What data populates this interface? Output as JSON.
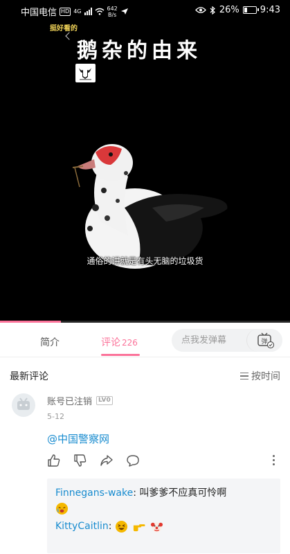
{
  "status_bar": {
    "carrier": "中国电信",
    "network": "4G",
    "speed_value": "642",
    "speed_unit": "B/s",
    "battery": "26%",
    "battery_level": 0.26,
    "time": "9:43"
  },
  "video": {
    "tagline": "挺好看的",
    "title": "鹅杂的由来",
    "subtitle": "通俗的讲就是有头无脑的垃圾货",
    "progress": 0.21
  },
  "tabs": {
    "intro": "简介",
    "comments": "评论",
    "comments_count": "226",
    "danmu_placeholder": "点我发弹幕",
    "danmu_toggle_glyph": "弹"
  },
  "comments_section": {
    "title": "最新评论",
    "sort_label": "按时间"
  },
  "comment": {
    "username": "账号已注销",
    "level": "LV0",
    "date": "5-12",
    "text": "@中国警察网",
    "replies": [
      {
        "name": "Finnegans-wake",
        "text": "叫爹爹不应真可怜啊"
      },
      {
        "name": "KittyCaitlin",
        "text": ""
      }
    ]
  },
  "colors": {
    "accent": "#fb7299",
    "link": "#178bcf",
    "tagline": "#f5d75a"
  }
}
